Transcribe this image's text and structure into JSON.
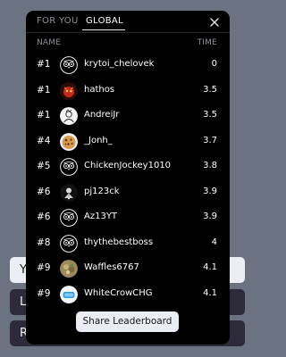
{
  "background_buttons": [
    {
      "label": "Y",
      "style": "light"
    },
    {
      "label": "L",
      "style": "dark"
    },
    {
      "label": "R",
      "style": "dark"
    }
  ],
  "modal": {
    "tabs": [
      {
        "label": "FOR YOU",
        "active": false
      },
      {
        "label": "GLOBAL",
        "active": true
      }
    ],
    "close_icon": "close-icon",
    "columns": {
      "name": "NAME",
      "time": "TIME"
    },
    "rows": [
      {
        "rank": "#1",
        "name": "krytoi_chelovek",
        "time": "0",
        "avatar": "owl-avatar"
      },
      {
        "rank": "#1",
        "name": "hathos",
        "time": "3.5",
        "avatar": "red-avatar"
      },
      {
        "rank": "#1",
        "name": "AndreiJr",
        "time": "3.5",
        "avatar": "sketch-avatar"
      },
      {
        "rank": "#4",
        "name": "_Jonh_",
        "time": "3.7",
        "avatar": "cookie-avatar"
      },
      {
        "rank": "#5",
        "name": "ChickenJockey1010",
        "time": "3.8",
        "avatar": "owl-avatar"
      },
      {
        "rank": "#6",
        "name": "pj123ck",
        "time": "3.9",
        "avatar": "dark-avatar"
      },
      {
        "rank": "#6",
        "name": "Az13YT",
        "time": "3.9",
        "avatar": "owl-avatar"
      },
      {
        "rank": "#8",
        "name": "thythebestboss",
        "time": "4",
        "avatar": "owl-avatar"
      },
      {
        "rank": "#9",
        "name": "Waffles6767",
        "time": "4.1",
        "avatar": "photo-avatar"
      },
      {
        "rank": "#9",
        "name": "WhiteCrowCHG",
        "time": "4.1",
        "avatar": "blue-avatar"
      }
    ],
    "share_label": "Share Leaderboard"
  }
}
